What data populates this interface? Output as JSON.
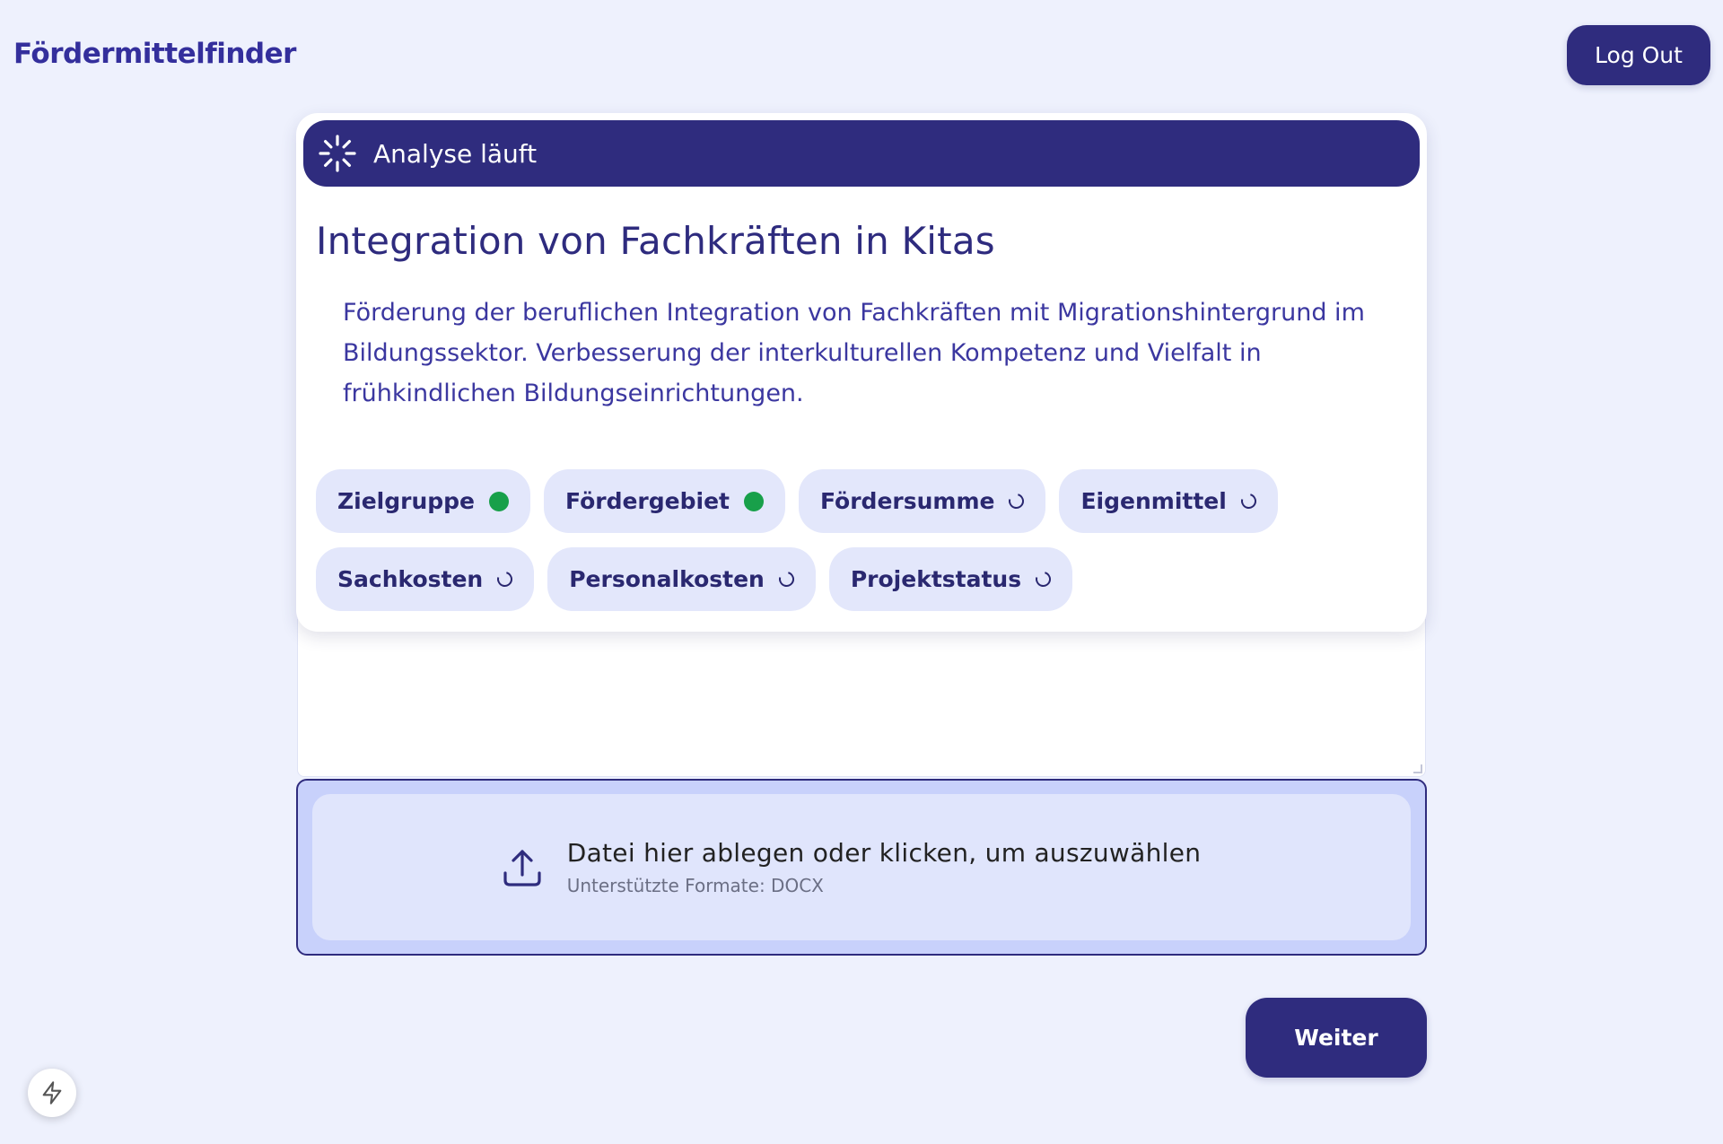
{
  "header": {
    "brand": "Fördermittelfinder",
    "logout_label": "Log Out"
  },
  "analysis": {
    "status_label": "Analyse läuft",
    "title": "Integration von Fachkräften in Kitas",
    "description": "Förderung der beruflichen Integration von Fachkräften mit Migrationshintergrund im Bildungssektor. Verbesserung der interkulturellen Kompetenz und Vielfalt in frühkindlichen Bildungseinrichtungen.",
    "chips": [
      {
        "label": "Zielgruppe",
        "state": "done"
      },
      {
        "label": "Fördergebiet",
        "state": "done"
      },
      {
        "label": "Fördersumme",
        "state": "loading"
      },
      {
        "label": "Eigenmittel",
        "state": "loading"
      },
      {
        "label": "Sachkosten",
        "state": "loading"
      },
      {
        "label": "Personalkosten",
        "state": "loading"
      },
      {
        "label": "Projektstatus",
        "state": "loading"
      }
    ]
  },
  "upload": {
    "main_text": "Datei hier ablegen oder klicken, um auszuwählen",
    "sub_text": "Unterstützte Formate: DOCX"
  },
  "footer": {
    "next_label": "Weiter"
  },
  "colors": {
    "primary": "#2f2c7e",
    "background": "#eef1fd",
    "chip_bg": "#e3e7fb",
    "done_dot": "#18a04a",
    "dropzone_bg": "#c8d1fb"
  },
  "icons": {
    "status": "loader-icon",
    "upload": "upload-icon",
    "dev": "bolt-icon"
  }
}
